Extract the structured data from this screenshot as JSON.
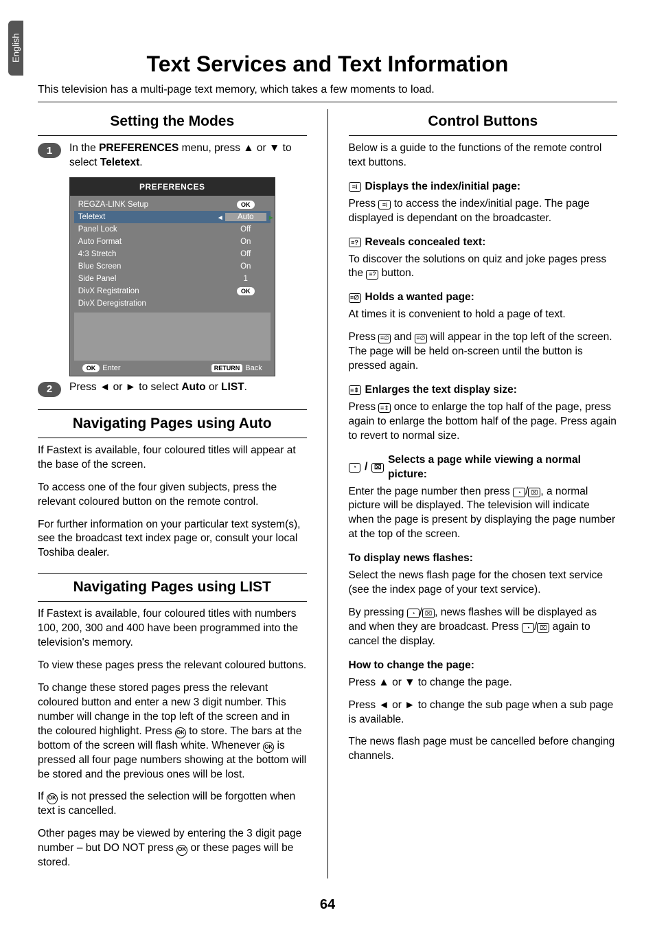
{
  "lang_tab": "English",
  "page_number": "64",
  "title": "Text Services and Text Information",
  "intro": "This television has a multi-page text memory, which takes a few moments to load.",
  "left": {
    "sect1_title": "Setting the Modes",
    "step1_a": "In the ",
    "step1_b": "PREFERENCES",
    "step1_c": " menu, press ▲ or ▼ to select ",
    "step1_d": "Teletext",
    "step1_e": ".",
    "step2_a": "Press ◄ or ► to select ",
    "step2_b": "Auto",
    "step2_c": " or ",
    "step2_d": "LIST",
    "step2_e": ".",
    "sect2_title": "Navigating Pages using Auto",
    "s2_p1": "If Fastext is available, four coloured titles will appear at the base of the screen.",
    "s2_p2": "To access one of the four given subjects, press the relevant coloured button on the remote control.",
    "s2_p3": "For further information on your particular text system(s), see the broadcast text index page or, consult your local Toshiba dealer.",
    "sect3_title": "Navigating Pages using LIST",
    "s3_p1": "If Fastext is available, four coloured titles with numbers 100, 200, 300 and 400 have been programmed into the television's memory.",
    "s3_p2": "To view these pages press the relevant coloured buttons.",
    "s3_p3_a": "To change these stored pages press the relevant coloured button and enter a new 3 digit number. This number will change in the top left of the screen and in the coloured highlight. Press ",
    "s3_p3_b": " to store. The bars at the bottom of the screen will flash white. Whenever ",
    "s3_p3_c": " is pressed all four page numbers showing at the bottom will be stored and the previous ones will be lost.",
    "s3_p4_a": "If ",
    "s3_p4_b": " is not pressed the selection will be forgotten when text is cancelled.",
    "s3_p5_a": "Other pages may be viewed by entering the 3 digit page number – but DO NOT press ",
    "s3_p5_b": " or these pages will be stored."
  },
  "right": {
    "sect_title": "Control Buttons",
    "p_intro": "Below is a guide to the functions of the remote control text buttons.",
    "h_index": "Displays the index/initial page:",
    "p_index_a": "Press ",
    "p_index_b": " to access the index/initial page. The page displayed is dependant on the broadcaster.",
    "h_reveal": "Reveals concealed text:",
    "p_reveal_a": "To discover the solutions on quiz and joke pages press the ",
    "p_reveal_b": " button.",
    "h_hold": "Holds a wanted page:",
    "p_hold_1": "At times it is convenient to hold a page of text.",
    "p_hold_2a": "Press ",
    "p_hold_2b": " and ",
    "p_hold_2c": " will appear in the top left of the screen. The page will be held on-screen until the button is pressed again.",
    "h_enlarge": "Enlarges the text display size:",
    "p_enlarge_a": "Press ",
    "p_enlarge_b": " once to enlarge the top half of the page, press again to enlarge the bottom half of the page. Press again to revert to normal size.",
    "h_select": "Selects a page while viewing a normal picture:",
    "p_select_a": "Enter the page number then press ",
    "p_select_b": ", a normal picture will be displayed. The television will indicate when the page is present by displaying the page number at the top of the screen.",
    "h_flash": "To display news flashes:",
    "p_flash_1": "Select the news flash page for the chosen text service (see the index page of your text service).",
    "p_flash_2a": "By pressing ",
    "p_flash_2b": ", news flashes will be displayed as and when they are broadcast. Press ",
    "p_flash_2c": " again to cancel the display.",
    "h_change": "How to change the page:",
    "p_change_1": "Press ▲ or ▼ to change the page.",
    "p_change_2": "Press ◄ or ► to change the sub page when a sub page is available.",
    "p_change_3": "The news flash page must be cancelled before changing channels."
  },
  "panel": {
    "title": "PREFERENCES",
    "rows": [
      {
        "label": "REGZA-LINK Setup",
        "value": "OK"
      },
      {
        "label": "Teletext",
        "value": "Auto"
      },
      {
        "label": "Panel Lock",
        "value": "Off"
      },
      {
        "label": "Auto Format",
        "value": "On"
      },
      {
        "label": "4:3 Stretch",
        "value": "Off"
      },
      {
        "label": "Blue Screen",
        "value": "On"
      },
      {
        "label": "Side Panel",
        "value": "1"
      },
      {
        "label": "DivX Registration",
        "value": "OK"
      },
      {
        "label": "DivX Deregistration",
        "value": ""
      }
    ],
    "footer_enter": "Enter",
    "footer_back": "Back",
    "footer_ok": "OK",
    "footer_return": "RETURN"
  },
  "icons": {
    "i": "≡i",
    "q": "≡?",
    "hold": "≡∅",
    "size": "≡⇕",
    "clock": "◔",
    "tv": "⌧",
    "ok": "OK"
  }
}
